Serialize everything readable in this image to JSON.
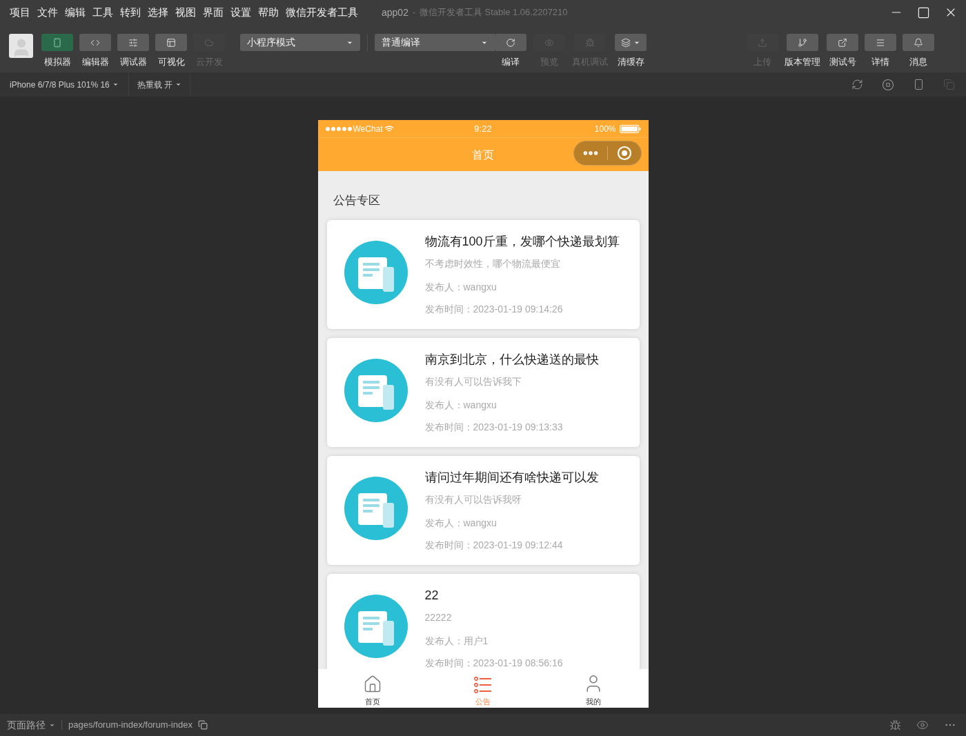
{
  "menu_bar": {
    "items": [
      "项目",
      "文件",
      "编辑",
      "工具",
      "转到",
      "选择",
      "视图",
      "界面",
      "设置",
      "帮助",
      "微信开发者工具"
    ],
    "title": "app02",
    "separator": "-",
    "version": "微信开发者工具 Stable 1.06.2207210"
  },
  "toolbar": {
    "left": [
      {
        "kind": "phone",
        "label": "模拟器",
        "selected": true,
        "disabled": false
      },
      {
        "kind": "code",
        "label": "编辑器",
        "selected": false,
        "disabled": false
      },
      {
        "kind": "sliders",
        "label": "调试器",
        "selected": false,
        "disabled": false
      },
      {
        "kind": "layout",
        "label": "可视化",
        "selected": false,
        "disabled": false
      },
      {
        "kind": "cloud",
        "label": "云开发",
        "selected": false,
        "disabled": true
      }
    ],
    "mode_select": {
      "value": "小程序模式"
    },
    "compile_select": {
      "value": "普通编译"
    },
    "actions": [
      {
        "kind": "refresh",
        "label": "编译",
        "disabled": false
      },
      {
        "kind": "eye",
        "label": "预览",
        "disabled": true
      },
      {
        "kind": "bug",
        "label": "真机调试",
        "disabled": true
      },
      {
        "kind": "layers",
        "label": "清缓存",
        "disabled": false
      }
    ],
    "right": [
      {
        "kind": "upload",
        "label": "上传",
        "disabled": true
      },
      {
        "kind": "branch",
        "label": "版本管理",
        "disabled": false
      },
      {
        "kind": "external",
        "label": "测试号",
        "disabled": false
      },
      {
        "kind": "menu",
        "label": "详情",
        "disabled": false
      },
      {
        "kind": "bell",
        "label": "消息",
        "disabled": false
      }
    ]
  },
  "device_bar": {
    "device": "iPhone 6/7/8 Plus 101% 16",
    "hot_reload": "热重载 开"
  },
  "phone": {
    "status": {
      "carrier": "WeChat",
      "time": "9:22",
      "battery": "100%"
    },
    "nav_title": "首页",
    "section_title": "公告专区",
    "posts": [
      {
        "title": "物流有100斤重，发哪个快递最划算",
        "summary": "不考虑时效性，哪个物流最便宜",
        "author": "发布人：wangxu",
        "time": "发布时间：2023-01-19 09:14:26"
      },
      {
        "title": "南京到北京，什么快递送的最快",
        "summary": "有没有人可以告诉我下",
        "author": "发布人：wangxu",
        "time": "发布时间：2023-01-19 09:13:33"
      },
      {
        "title": "请问过年期间还有啥快递可以发",
        "summary": "有没有人可以告诉我呀",
        "author": "发布人：wangxu",
        "time": "发布时间：2023-01-19 09:12:44"
      },
      {
        "title": "22",
        "summary": "22222",
        "author": "发布人：用户1",
        "time": "发布时间：2023-01-19 08:56:16"
      }
    ],
    "tabs": [
      {
        "kind": "home",
        "label": "首页",
        "selected": false
      },
      {
        "kind": "list",
        "label": "公告",
        "selected": true
      },
      {
        "kind": "user",
        "label": "我的",
        "selected": false
      }
    ]
  },
  "status_bar": {
    "label": "页面路径",
    "path": "pages/forum-index/forum-index"
  }
}
